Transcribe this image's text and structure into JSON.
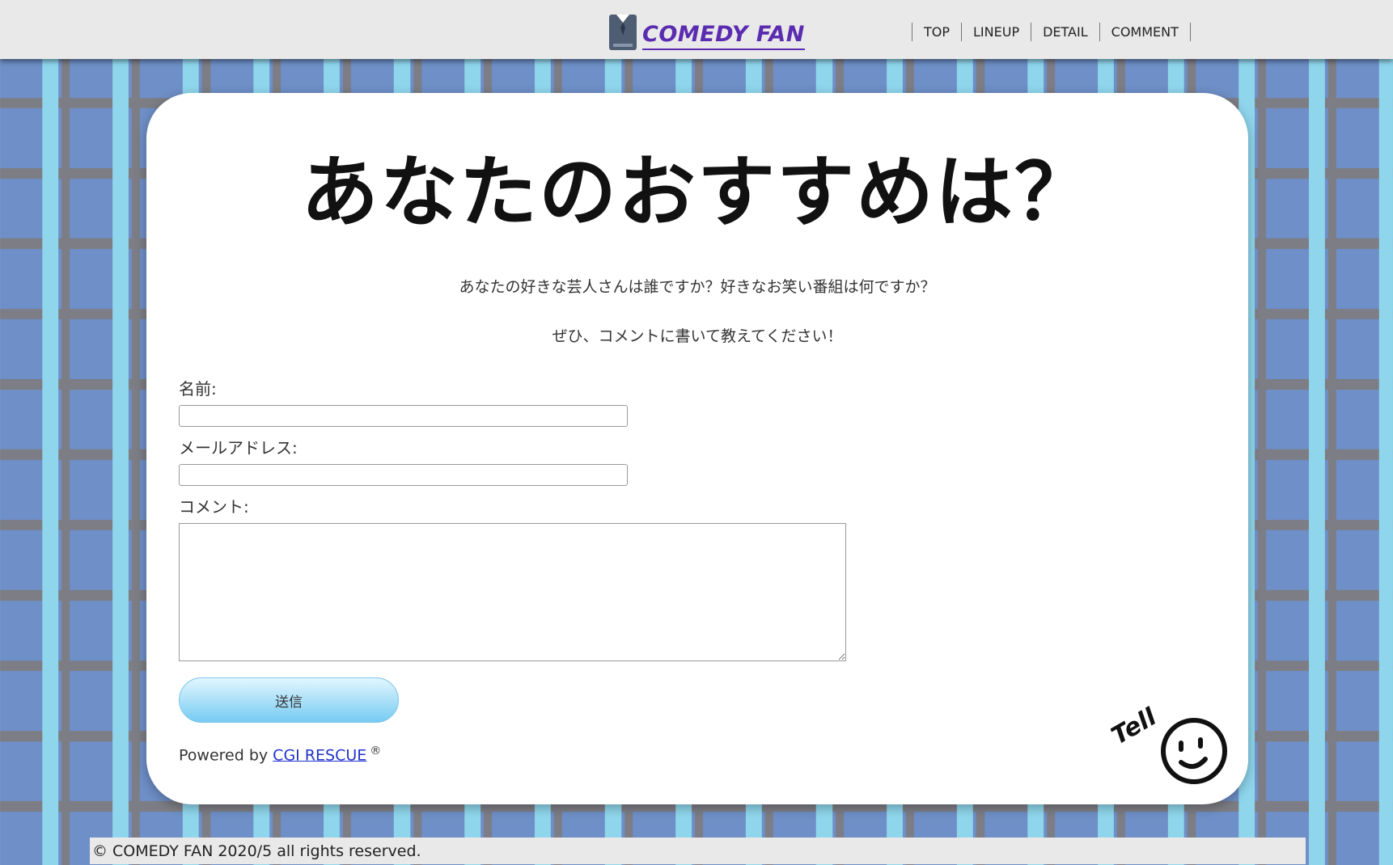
{
  "header": {
    "logo_text": "COMEDY FAN",
    "logo_icon": "shirt-icon",
    "nav": [
      "TOP",
      "LINEUP",
      "DETAIL",
      "COMMENT"
    ]
  },
  "main": {
    "title": "あなたのおすすめは？",
    "description_1": "あなたの好きな芸人さんは誰ですか？好きなお笑い番組は何ですか？",
    "description_2": "ぜひ、コメントに書いて教えてください！"
  },
  "form": {
    "name_label": "名前:",
    "name_value": "",
    "email_label": "メールアドレス:",
    "email_value": "",
    "comment_label": "コメント:",
    "comment_value": "",
    "submit_label": "送信"
  },
  "powered": {
    "prefix": "Powered by",
    "link_text": "CGI RESCUE",
    "mark": "®"
  },
  "decoration": {
    "tell_text": "Tell",
    "tell_icon": "smiley-face-icon"
  },
  "footer": {
    "copyright": "© COMEDY FAN 2020/5 all rights reserved."
  },
  "colors": {
    "logo": "#5b2bb0",
    "background_blue": "#6e8fc7",
    "stripe_light": "#8fd6ec",
    "button_gradient_end": "#76cbf2",
    "link": "#2233cc"
  }
}
